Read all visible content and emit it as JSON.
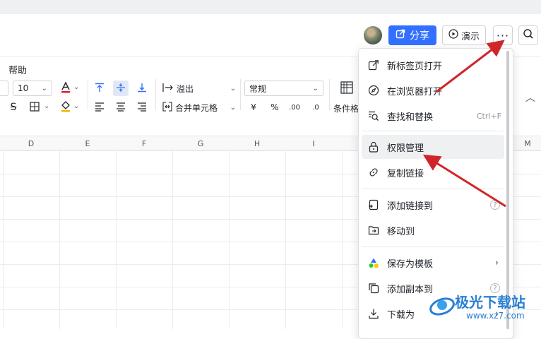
{
  "header": {
    "share_label": "分享",
    "present_label": "演示",
    "more_label": "···"
  },
  "menubar": {
    "help_label": "帮助"
  },
  "toolbar": {
    "font_size": "10",
    "overflow_label": "溢出",
    "merge_label": "合并单元格",
    "format_value": "常规",
    "conditional_label": "条件格",
    "currency_symbol": "¥",
    "percent_symbol": "%",
    "decimal_add": ".00",
    "decimal_remove": ".0"
  },
  "columns": [
    "D",
    "E",
    "F",
    "G",
    "H",
    "I",
    "M"
  ],
  "dropdown": {
    "items": [
      {
        "label": "新标签页打开",
        "icon": "open-new-tab-icon"
      },
      {
        "label": "在浏览器打开",
        "icon": "compass-icon"
      },
      {
        "label": "查找和替换",
        "icon": "find-replace-icon",
        "shortcut": "Ctrl+F"
      },
      {
        "label": "权限管理",
        "icon": "lock-icon"
      },
      {
        "label": "复制链接",
        "icon": "link-icon"
      },
      {
        "label": "添加链接到",
        "icon": "add-link-icon",
        "help": "?"
      },
      {
        "label": "移动到",
        "icon": "folder-move-icon"
      },
      {
        "label": "保存为模板",
        "icon": "template-icon",
        "chevron": "›"
      },
      {
        "label": "添加副本到",
        "icon": "copy-icon",
        "help": "?"
      },
      {
        "label": "下载为",
        "icon": "download-icon",
        "chevron": "›"
      }
    ]
  },
  "watermark": {
    "text": "极光下载站",
    "url": "www.xz7.com"
  },
  "colors": {
    "accent": "#3370ff",
    "arrow": "#d0262a"
  }
}
